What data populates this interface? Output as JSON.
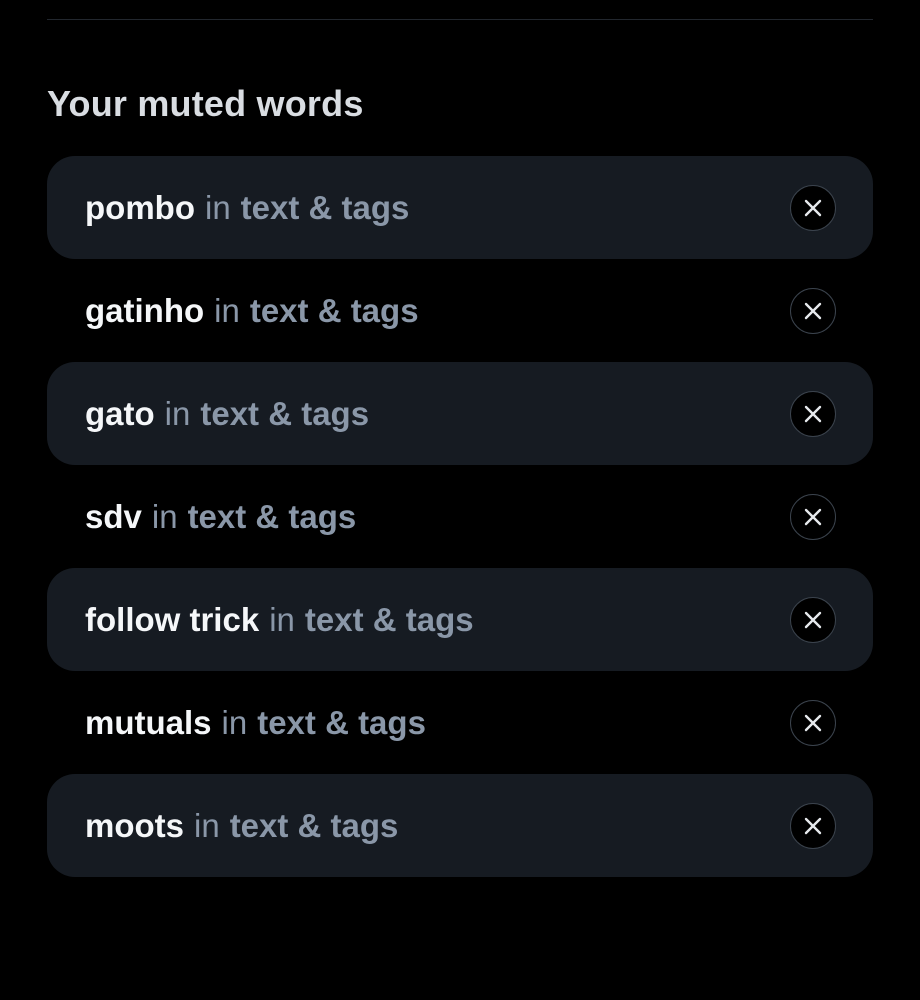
{
  "section": {
    "title": "Your muted words"
  },
  "muted_words": [
    {
      "word": "pombo",
      "in": "in",
      "target": "text & tags",
      "remove_icon": "close-icon"
    },
    {
      "word": "gatinho",
      "in": "in",
      "target": "text & tags",
      "remove_icon": "close-icon"
    },
    {
      "word": "gato",
      "in": "in",
      "target": "text & tags",
      "remove_icon": "close-icon"
    },
    {
      "word": "sdv",
      "in": "in",
      "target": "text & tags",
      "remove_icon": "close-icon"
    },
    {
      "word": "follow trick",
      "in": "in",
      "target": "text & tags",
      "remove_icon": "close-icon"
    },
    {
      "word": "mutuals",
      "in": "in",
      "target": "text & tags",
      "remove_icon": "close-icon"
    },
    {
      "word": "moots",
      "in": "in",
      "target": "text & tags",
      "remove_icon": "close-icon"
    }
  ],
  "colors": {
    "background": "#000000",
    "row_shaded": "#161b22",
    "muted_text": "#8a97a8",
    "primary_text": "#f5f7f9"
  }
}
